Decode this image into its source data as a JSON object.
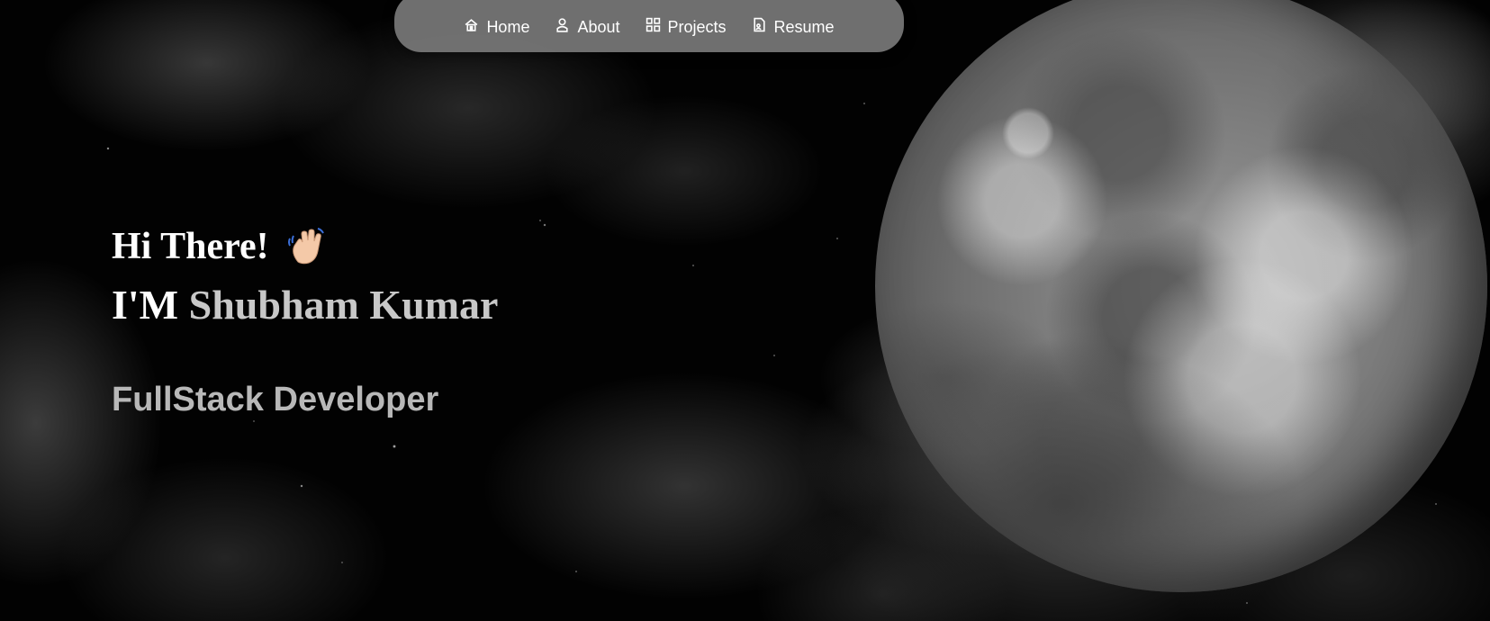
{
  "nav": {
    "items": [
      {
        "label": "Home",
        "icon": "home-icon"
      },
      {
        "label": "About",
        "icon": "user-icon"
      },
      {
        "label": "Projects",
        "icon": "grid-icon"
      },
      {
        "label": "Resume",
        "icon": "document-icon"
      }
    ]
  },
  "hero": {
    "greeting": "Hi There!",
    "wave_icon": "waving-hand-icon",
    "intro_prefix": "I'M",
    "name": "Shubham Kumar",
    "role": "FullStack Developer"
  },
  "colors": {
    "navbar_bg": "#787878",
    "name_text": "#c8c8c8",
    "role_text": "#b8b8b8"
  }
}
